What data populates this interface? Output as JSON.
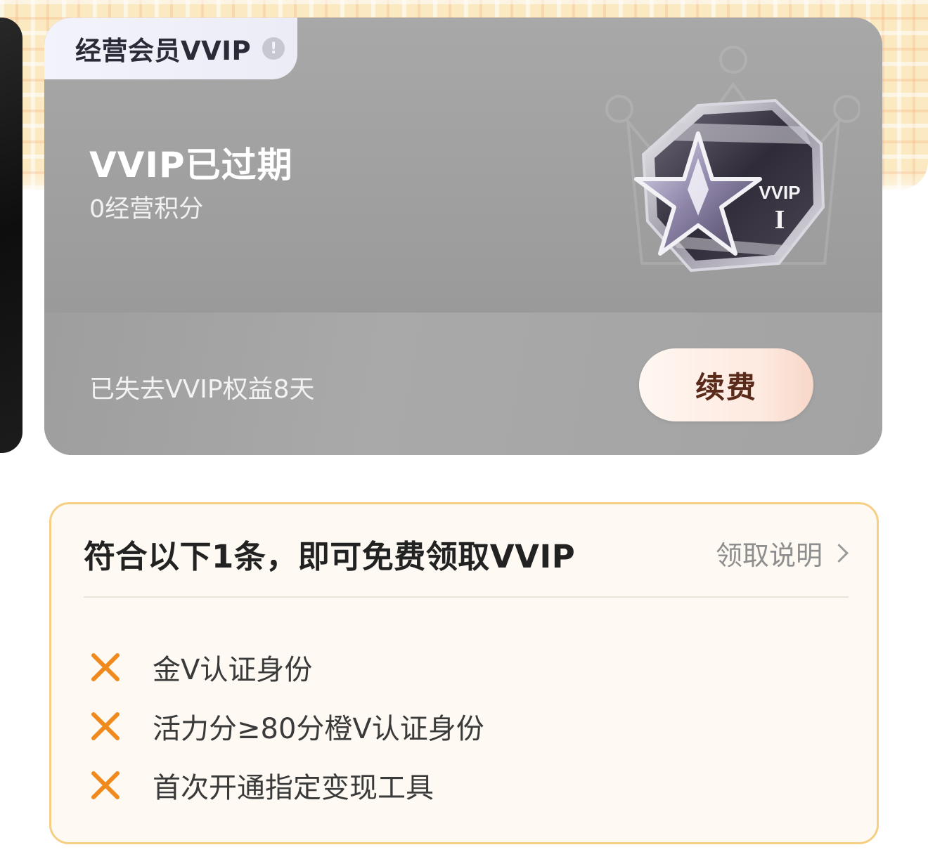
{
  "card": {
    "tab_label": "经营会员VVIP",
    "status_title": "VVIP已过期",
    "points": "0经营积分",
    "expired_text": "已失去VVIP权益8天",
    "renew_label": "续费",
    "badge": {
      "title": "VVIP",
      "level": "I",
      "icon": "star-badge-icon"
    }
  },
  "eligibility": {
    "title": "符合以下1条，即可免费领取VVIP",
    "link_label": "领取说明",
    "conditions": [
      {
        "text": "金V认证身份",
        "met": false
      },
      {
        "text": "活力分≥80分橙V认证身份",
        "met": false
      },
      {
        "text": "首次开通指定变现工具",
        "met": false
      }
    ]
  },
  "colors": {
    "accent_orange": "#f08a1c",
    "card_grey": "#a3a3a3",
    "box_border": "#f6cf84",
    "button_text": "#5a2a1a"
  }
}
